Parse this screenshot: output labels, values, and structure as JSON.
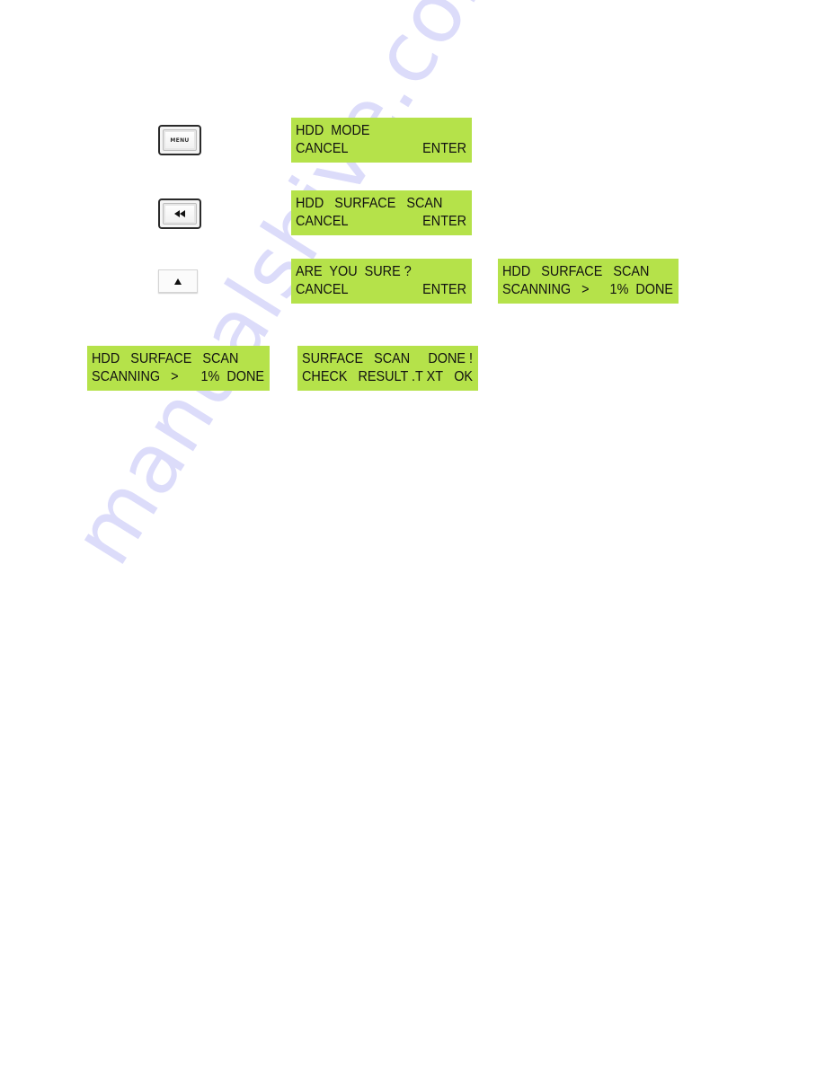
{
  "watermark": "manualshive.com",
  "buttons": {
    "menu": {
      "label": "MENU",
      "icon": "menu-key"
    },
    "rewind": {
      "icon": "rewind-icon",
      "glyph": "◀◀"
    },
    "up": {
      "icon": "up-arrow-icon",
      "glyph": "▲"
    }
  },
  "lcd_color": "#B5E24A",
  "screens": {
    "hdd_mode": {
      "line1_left": "HDD  MODE",
      "line1_right": "",
      "line2_left": "CANCEL",
      "line2_right": "ENTER"
    },
    "surface_scan": {
      "line1_left": "HDD   SURFACE   SCAN",
      "line1_right": "",
      "line2_left": "CANCEL",
      "line2_right": "ENTER"
    },
    "confirm": {
      "line1_left": "ARE  YOU  SURE ?",
      "line1_right": "",
      "line2_left": "CANCEL",
      "line2_right": "ENTER"
    },
    "scanning_a": {
      "line1_left": "HDD   SURFACE   SCAN",
      "line1_right": "",
      "line2_left": "SCANNING   >",
      "line2_right": "1%  DONE"
    },
    "scanning_b": {
      "line1_left": "HDD   SURFACE   SCAN",
      "line1_right": "",
      "line2_left": "SCANNING   >",
      "line2_right": "1%  DONE"
    },
    "done": {
      "line1_left": "SURFACE   SCAN",
      "line1_right": "DONE !",
      "line2_left": "CHECK   RESULT .T XT",
      "line2_right": "OK"
    }
  }
}
